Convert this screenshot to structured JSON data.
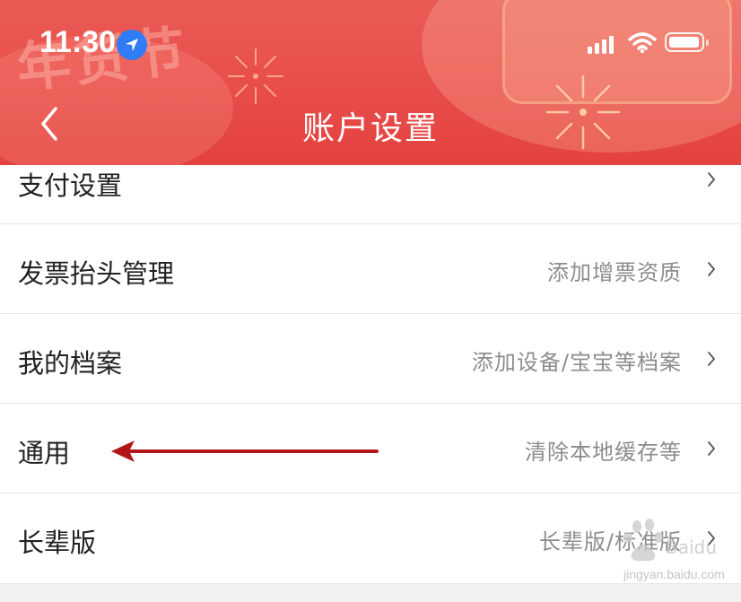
{
  "status_bar": {
    "time": "11:30"
  },
  "header": {
    "title": "账户设置",
    "decoration_text": "年货节",
    "background_color": "#e84d4b"
  },
  "list": {
    "items": [
      {
        "label": "支付设置",
        "value": ""
      },
      {
        "label": "发票抬头管理",
        "value": "添加增票资质"
      },
      {
        "label": "我的档案",
        "value": "添加设备/宝宝等档案"
      },
      {
        "label": "通用",
        "value": "清除本地缓存等"
      },
      {
        "label": "长辈版",
        "value": "长辈版/标准版"
      }
    ]
  },
  "annotation": {
    "arrow_color": "#b3161a",
    "points_to": "通用"
  },
  "watermark": {
    "text": "jingyan.baidu.com",
    "brand": "Baidu经验"
  },
  "icons": [
    "location-arrow-icon",
    "signal-icon",
    "wifi-icon",
    "battery-icon",
    "back-chevron-icon",
    "chevron-right-icon"
  ]
}
